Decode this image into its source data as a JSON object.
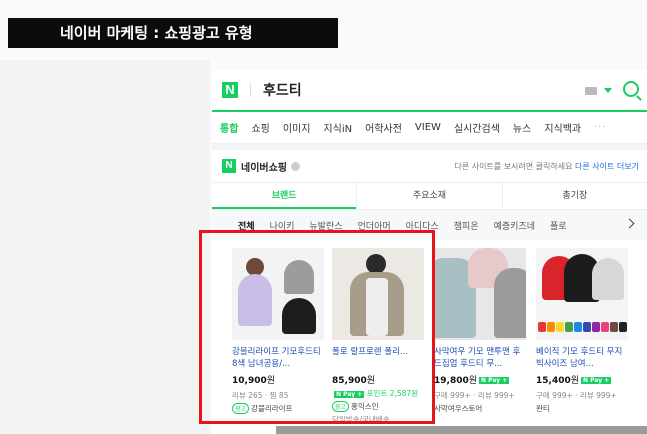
{
  "slide_title": "네이버 마케팅 : 쇼핑광고 유형",
  "search": {
    "logo": "N",
    "query": "후드티"
  },
  "tabs": [
    "통합",
    "쇼핑",
    "이미지",
    "지식iN",
    "어학사전",
    "VIEW",
    "실시간검색",
    "뉴스",
    "지식백과",
    "···"
  ],
  "active_tab": "통합",
  "shopping": {
    "logo": "N",
    "name": "네이버쇼핑",
    "notice_text": "다른 사이트를 보시려면 클릭하세요",
    "notice_link": "다른 사이트 더보기"
  },
  "segments": [
    "브랜드",
    "주요소재",
    "총기장"
  ],
  "active_segment": "브랜드",
  "brands": [
    "전체",
    "나이키",
    "뉴발란스",
    "언더아머",
    "아디다스",
    "챔피온",
    "예증키즈네",
    "폴로"
  ],
  "active_brand": "전체",
  "products": [
    {
      "name": "강블리라이프 기모후드티 8색 남녀공용/...",
      "price": "10,900",
      "unit": "원",
      "npay": "N Pay +",
      "point": "",
      "meta": "리뷰 265 · 찜 85",
      "ad": "광고",
      "seller": "강블리라이프",
      "shipping": ""
    },
    {
      "name": "폴로 랄프로렌 폴리...",
      "price": "85,900",
      "unit": "원",
      "npay": "N Pay +",
      "point": "포인트 2,587원",
      "meta": "",
      "ad": "광고",
      "seller": "홍익스인",
      "shipping": "당일발송/국내배송"
    },
    {
      "name": "사막여우 기모 맨투맨 후드집업 후드티 무...",
      "price": "19,800",
      "unit": "원",
      "npay": "N Pay +",
      "point": "",
      "meta": "구매 999+ · 리뷰 999+",
      "ad": "",
      "seller": "사막여우스토어",
      "shipping": ""
    },
    {
      "name": "베이직 기모 후드티 무지 빅사이즈 남여...",
      "price": "15,400",
      "unit": "원",
      "npay": "N Pay +",
      "point": "",
      "meta": "구매 999+ · 리뷰 999+",
      "ad": "",
      "seller": "완티",
      "shipping": ""
    }
  ],
  "colors": {
    "naver_green": "#19ce60",
    "highlight_red": "#e8141a",
    "link_blue": "#1a4fb0"
  }
}
